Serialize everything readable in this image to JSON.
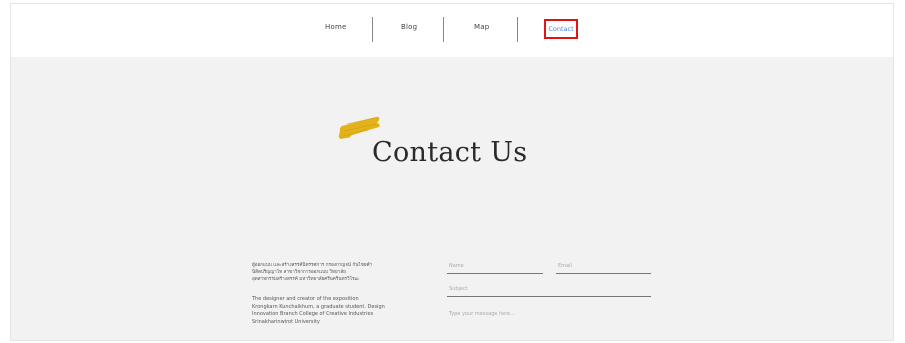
{
  "nav": {
    "items": [
      {
        "label": "Home"
      },
      {
        "label": "Blog"
      },
      {
        "label": "Map"
      },
      {
        "label": "Contact"
      }
    ],
    "active_color": "#4a7fd4",
    "highlight_color": "#e01414"
  },
  "hero": {
    "title": "Contact Us",
    "accent_color": "#e3b21a"
  },
  "info": {
    "thai_text": "ผู้ออกแบบ และสร้างสรรค์นิทรรศการ กรองกาญจน์ กันไชยคำ\nนิสิตปริญญาโท สาขาวิชาการออกแบบ วิทยาลัย\nอุตสาหกรรมสร้างสรรค์ มหาวิทยาลัยศรีนครินทรวิโรฒ",
    "english_text": "The designer and creator of the exposition\nKrongkarn Kunchaikhum, a graduate student. Design\nInnovation Branch College of Creative Industries\nSrinakharinwirot University"
  },
  "form": {
    "name_placeholder": "Name",
    "email_placeholder": "Email",
    "subject_placeholder": "Subject",
    "message_placeholder": "Type your message here..."
  }
}
